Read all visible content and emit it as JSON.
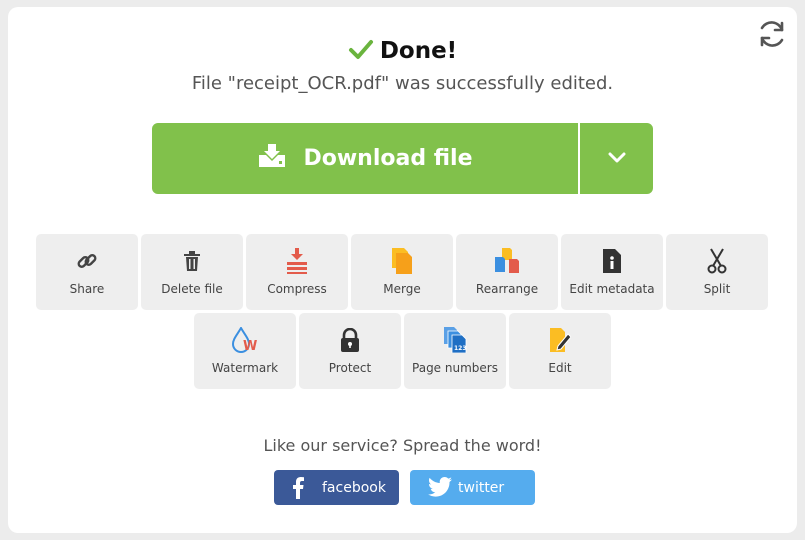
{
  "status": {
    "title": "Done!",
    "message": "File \"receipt_OCR.pdf\" was successfully edited."
  },
  "download": {
    "label": "Download file",
    "icon": "download-icon",
    "dropdown_icon": "chevron-down-icon"
  },
  "tools": [
    {
      "label": "Share",
      "icon": "link-icon"
    },
    {
      "label": "Delete file",
      "icon": "trash-icon"
    },
    {
      "label": "Compress",
      "icon": "compress-icon"
    },
    {
      "label": "Merge",
      "icon": "merge-icon"
    },
    {
      "label": "Rearrange",
      "icon": "rearrange-icon"
    },
    {
      "label": "Edit metadata",
      "icon": "info-document-icon"
    },
    {
      "label": "Split",
      "icon": "scissors-icon"
    },
    {
      "label": "Watermark",
      "icon": "watermark-icon"
    },
    {
      "label": "Protect",
      "icon": "lock-icon"
    },
    {
      "label": "Page numbers",
      "icon": "page-numbers-icon"
    },
    {
      "label": "Edit",
      "icon": "edit-icon"
    }
  ],
  "social": {
    "prompt": "Like our service? Spread the word!",
    "facebook_label": "facebook",
    "twitter_label": "twitter"
  },
  "colors": {
    "accent_green": "#81c14b",
    "check_green": "#6ab43e",
    "facebook_blue": "#3b5998",
    "twitter_blue": "#55acee",
    "tool_bg": "#eeeeee"
  }
}
